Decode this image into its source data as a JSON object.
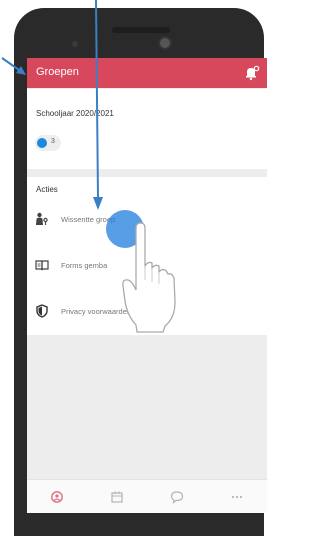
{
  "app_bar": {
    "title": "Groepen",
    "notification_icon": "bell-badge-icon"
  },
  "groups_card": {
    "school_year": "Schooljaar 2020/2021",
    "chip_count": "3",
    "chip_color": "#1a8ae0"
  },
  "actions_card": {
    "title": "Acties",
    "items": [
      {
        "label": "Wissentte groep",
        "icon": "person-key-icon"
      },
      {
        "label": "Forms gemba",
        "icon": "book-icon"
      },
      {
        "label": "Privacy voorwaarden",
        "icon": "shield-icon"
      }
    ]
  },
  "bottom_nav": [
    {
      "icon": "groups-icon",
      "active": true
    },
    {
      "icon": "calendar-icon",
      "active": false
    },
    {
      "icon": "chat-icon",
      "active": false
    },
    {
      "icon": "more-icon",
      "active": false
    }
  ],
  "colors": {
    "accent": "#d8485c",
    "annotation_arrow": "#3a7fc4",
    "tap_highlight": "#1878dc"
  }
}
